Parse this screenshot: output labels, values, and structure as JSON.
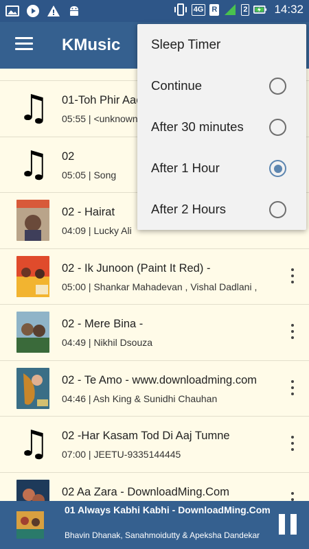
{
  "status_bar": {
    "time": "14:32",
    "network": "4G",
    "roaming": "R",
    "sim2": "2"
  },
  "app_bar": {
    "title": "KMusic"
  },
  "songs": [
    {
      "title": "01-Toh Phir Aao",
      "meta": "05:55 | <unknown>",
      "thumb": "music-note"
    },
    {
      "title": "02",
      "meta": "05:05 | Song",
      "thumb": "music-note"
    },
    {
      "title": "02 - Hairat",
      "meta": "04:09 | Lucky Ali",
      "thumb": "album-art"
    },
    {
      "title": "02 - Ik Junoon (Paint It Red) -",
      "meta": "05:00 | Shankar Mahadevan , Vishal Dadlani ,",
      "thumb": "album-art"
    },
    {
      "title": "02 - Mere Bina -",
      "meta": "04:49 | Nikhil Dsouza",
      "thumb": "album-art"
    },
    {
      "title": "02 - Te Amo - www.downloadming.com",
      "meta": "04:46 | Ash King & Sunidhi Chauhan",
      "thumb": "album-art"
    },
    {
      "title": "02 -Har Kasam Tod Di Aaj Tumne",
      "meta": "07:00 | JEETU-9335144445",
      "thumb": "music-note"
    },
    {
      "title": "02 Aa Zara  - DownloadMing.Com",
      "meta": "",
      "thumb": "album-art"
    }
  ],
  "now_playing": {
    "title": "01 Always Kabhi Kabhi  - DownloadMing.Com",
    "artist": "Bhavin Dhanak, Sanahmoidutty & Apeksha Dandekar"
  },
  "sleep_timer": {
    "header": "Sleep Timer",
    "options": [
      {
        "label": "Continue",
        "checked": false
      },
      {
        "label": "After 30 minutes",
        "checked": false
      },
      {
        "label": "After 1 Hour",
        "checked": true
      },
      {
        "label": "After 2 Hours",
        "checked": false
      }
    ],
    "accent_color": "#5d86b0"
  },
  "colors": {
    "app_bar": "#35608f",
    "status_bar": "#2e5688",
    "list_background": "#fffbe8"
  }
}
